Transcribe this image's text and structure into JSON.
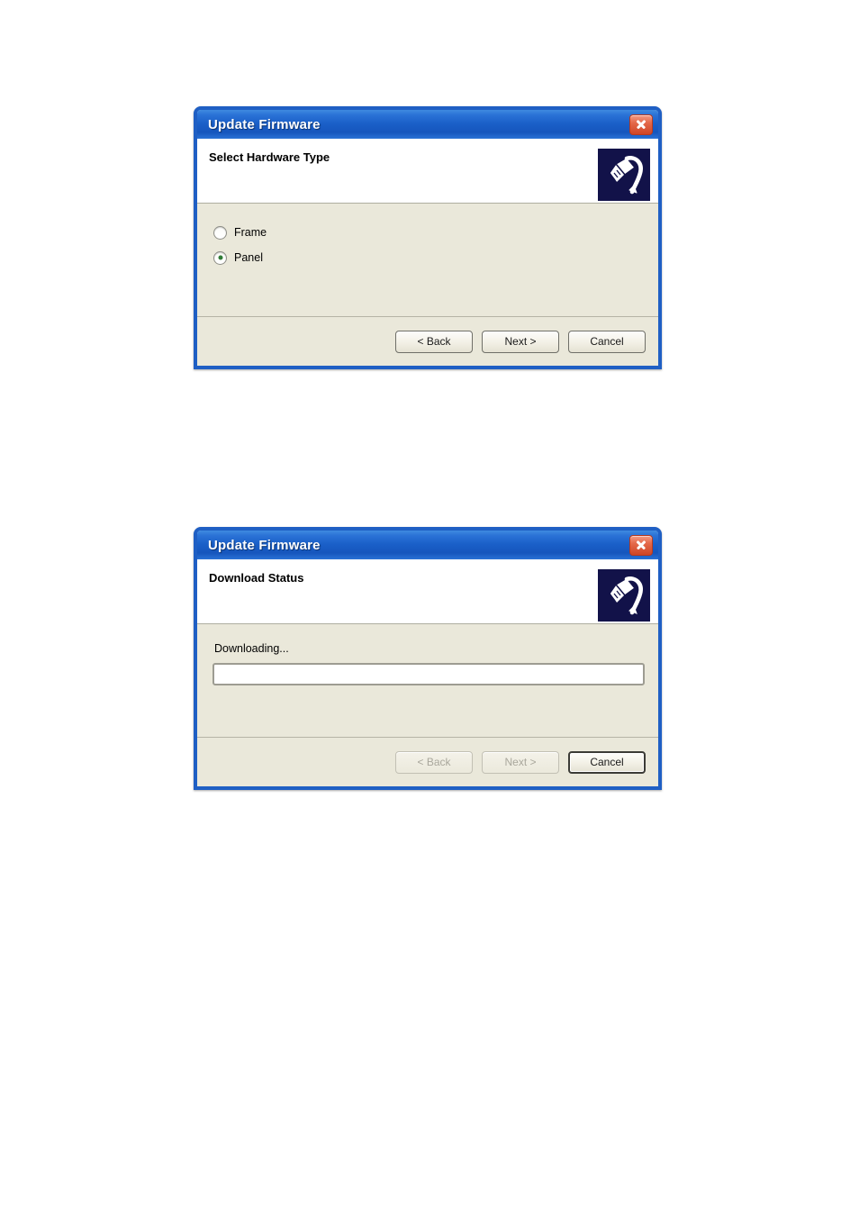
{
  "page": {
    "background": "#ffffff",
    "accent_blue": "#1a5fc8",
    "body_beige": "#eae8da",
    "icon_navy": "#121249",
    "close_red": "#cf4526",
    "radio_green": "#2f7b36"
  },
  "dialogs": [
    {
      "title": "Update Firmware",
      "heading": "Select Hardware Type",
      "icon": "rj45-connector-icon",
      "close_icon": "close-icon",
      "options": [
        {
          "label": "Frame",
          "selected": false
        },
        {
          "label": "Panel",
          "selected": true
        }
      ],
      "buttons": [
        {
          "label": "< Back",
          "enabled": true,
          "default": false
        },
        {
          "label": "Next >",
          "enabled": true,
          "default": false
        },
        {
          "label": "Cancel",
          "enabled": true,
          "default": false
        }
      ]
    },
    {
      "title": "Update Firmware",
      "heading": "Download Status",
      "icon": "rj45-connector-icon",
      "close_icon": "close-icon",
      "status_text": "Downloading...",
      "progress": {
        "percent": 0,
        "value_label": ""
      },
      "buttons": [
        {
          "label": "< Back",
          "enabled": false,
          "default": false
        },
        {
          "label": "Next >",
          "enabled": false,
          "default": false
        },
        {
          "label": "Cancel",
          "enabled": true,
          "default": true
        }
      ]
    }
  ]
}
